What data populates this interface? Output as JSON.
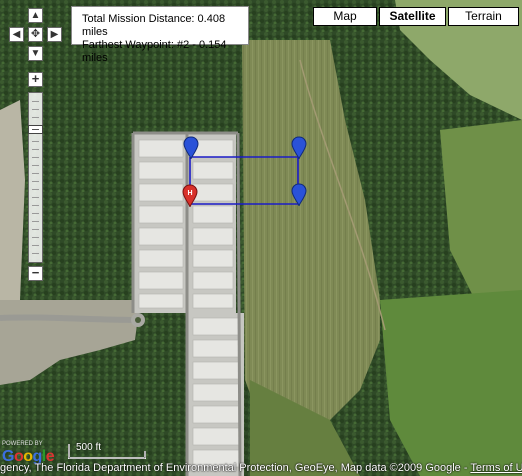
{
  "map_types": {
    "map_label": "Map",
    "satellite_label": "Satellite",
    "terrain_label": "Terrain",
    "selected": "Satellite"
  },
  "info": {
    "total_distance": "Total Mission Distance: 0.408 miles",
    "farthest_waypoint": "Farthest Waypoint: #2 - 0.154 miles"
  },
  "navigation": {
    "pan_up_icon": "arrow-up-icon",
    "pan_left_icon": "arrow-left-icon",
    "pan_right_icon": "arrow-right-icon",
    "pan_down_icon": "arrow-down-icon",
    "center_icon": "pan-center-icon",
    "zoom_in_label": "+",
    "zoom_out_label": "−"
  },
  "markers": {
    "home_label": "H",
    "home_color": "#d8312a",
    "waypoint_color": "#2a52d8",
    "route_color": "#1c1cc8"
  },
  "footer": {
    "scale_label": "500 ft",
    "powered_by": "POWERED BY",
    "logo": "Google",
    "attribution": "gency, The Florida Department of Environmental Protection, GeoEye, Map data ©2009 Google - ",
    "terms_link": "Terms of Use"
  }
}
